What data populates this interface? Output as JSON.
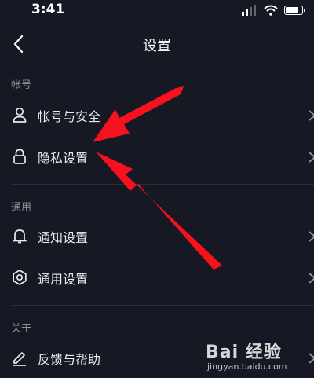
{
  "status_bar": {
    "time": "3:41"
  },
  "nav": {
    "title": "设置"
  },
  "sections": [
    {
      "header": "帐号",
      "items": [
        {
          "label": "帐号与安全",
          "icon": "user-icon"
        },
        {
          "label": "隐私设置",
          "icon": "lock-icon"
        }
      ]
    },
    {
      "header": "通用",
      "items": [
        {
          "label": "通知设置",
          "icon": "bell-icon"
        },
        {
          "label": "通用设置",
          "icon": "gear-icon"
        }
      ]
    },
    {
      "header": "关于",
      "items": [
        {
          "label": "反馈与帮助",
          "icon": "edit-icon"
        }
      ]
    }
  ],
  "watermark": {
    "brand": "Bai 经验",
    "url": "jingyan.baidu.com"
  },
  "colors": {
    "background": "#161823",
    "arrow": "#f5121d",
    "divider": "#2b2d37"
  },
  "battery_level": 0.9
}
